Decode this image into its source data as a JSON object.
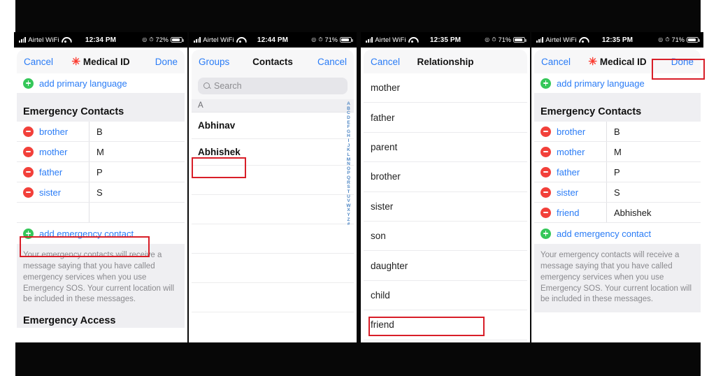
{
  "panels": [
    {
      "id": "medical-id-before",
      "status": {
        "carrier": "Airtel WiFi",
        "time": "12:34 PM",
        "battery": "72%"
      },
      "nav": {
        "left": "Cancel",
        "title": "Medical ID",
        "right": "Done"
      },
      "add_language": "add primary language",
      "section_title": "Emergency Contacts",
      "contacts": [
        {
          "relation": "brother",
          "name": "B"
        },
        {
          "relation": "mother",
          "name": "M"
        },
        {
          "relation": "father",
          "name": "P"
        },
        {
          "relation": "sister",
          "name": "S"
        }
      ],
      "add_contact": "add emergency contact",
      "footnote": "Your emergency contacts will receive a message saying that you have called emergency services when you use Emergency SOS. Your current location will be included in these messages.",
      "footer_title": "Emergency Access"
    },
    {
      "id": "contacts-picker",
      "status": {
        "carrier": "Airtel WiFi",
        "time": "12:44 PM",
        "battery": "71%"
      },
      "nav": {
        "left": "Groups",
        "title": "Contacts",
        "right": "Cancel"
      },
      "search_placeholder": "Search",
      "index_header": "A",
      "names": [
        "Abhinav",
        "Abhishek"
      ],
      "alpha_index": [
        "A",
        "B",
        "C",
        "D",
        "E",
        "F",
        "G",
        "H",
        "I",
        "J",
        "K",
        "L",
        "M",
        "N",
        "O",
        "P",
        "Q",
        "R",
        "S",
        "T",
        "U",
        "V",
        "W",
        "X",
        "Y",
        "Z",
        "#"
      ]
    },
    {
      "id": "relationship-picker",
      "status": {
        "carrier": "Airtel WiFi",
        "time": "12:35 PM",
        "battery": "71%"
      },
      "nav": {
        "left": "Cancel",
        "title": "Relationship",
        "right": ""
      },
      "relationships": [
        "mother",
        "father",
        "parent",
        "brother",
        "sister",
        "son",
        "daughter",
        "child",
        "friend"
      ]
    },
    {
      "id": "medical-id-after",
      "status": {
        "carrier": "Airtel WiFi",
        "time": "12:35 PM",
        "battery": "71%"
      },
      "nav": {
        "left": "Cancel",
        "title": "Medical ID",
        "right": "Done"
      },
      "add_language": "add primary language",
      "section_title": "Emergency Contacts",
      "contacts": [
        {
          "relation": "brother",
          "name": "B"
        },
        {
          "relation": "mother",
          "name": "M"
        },
        {
          "relation": "father",
          "name": "P"
        },
        {
          "relation": "sister",
          "name": "S"
        },
        {
          "relation": "friend",
          "name": "Abhishek"
        }
      ],
      "add_contact": "add emergency contact",
      "footnote": "Your emergency contacts will receive a message saying that you have called emergency services when you use Emergency SOS. Your current location will be included in these messages."
    }
  ],
  "highlight_color": "#d81e28"
}
